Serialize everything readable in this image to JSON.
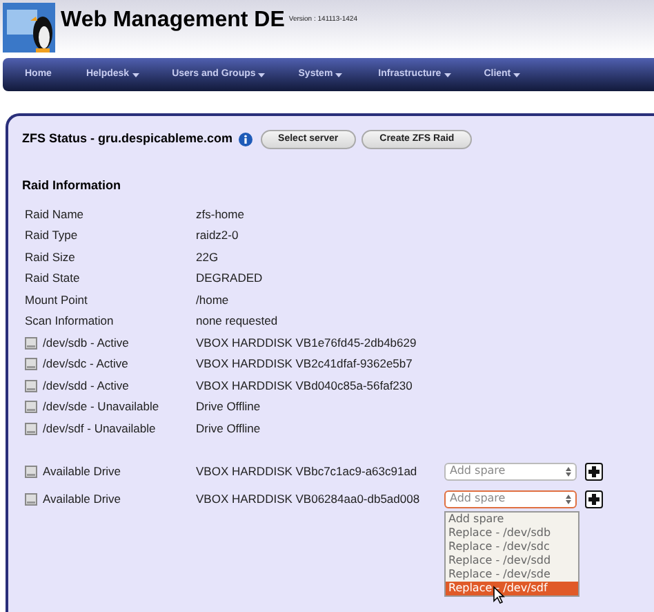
{
  "header": {
    "title": "Web Management DE",
    "version": "Version : 141113-1424"
  },
  "nav": [
    {
      "label": "Home",
      "has_menu": false
    },
    {
      "label": "Helpdesk",
      "has_menu": true
    },
    {
      "label": "Users and Groups",
      "has_menu": true
    },
    {
      "label": "System",
      "has_menu": true
    },
    {
      "label": "Infrastructure",
      "has_menu": true
    },
    {
      "label": "Client",
      "has_menu": true
    }
  ],
  "panel": {
    "title": "ZFS Status - gru.despicableme.com",
    "buttons": [
      "Select server",
      "Create ZFS Raid"
    ],
    "section_title": "Raid Information",
    "info": [
      {
        "label": "Raid Name",
        "value": "zfs-home"
      },
      {
        "label": "Raid Type",
        "value": "raidz2-0"
      },
      {
        "label": "Raid Size",
        "value": "22G"
      },
      {
        "label": "Raid State",
        "value": "DEGRADED"
      },
      {
        "label": "Mount Point",
        "value": "/home"
      },
      {
        "label": "Scan Information",
        "value": "none requested"
      }
    ],
    "drives": [
      {
        "label": "/dev/sdb - Active",
        "value": "VBOX HARDDISK VB1e76fd45-2db4b629"
      },
      {
        "label": "/dev/sdc - Active",
        "value": "VBOX HARDDISK VB2c41dfaf-9362e5b7"
      },
      {
        "label": "/dev/sdd - Active",
        "value": "VBOX HARDDISK VBd040c85a-56faf230"
      },
      {
        "label": "/dev/sde - Unavailable",
        "value": "Drive Offline"
      },
      {
        "label": "/dev/sdf - Unavailable",
        "value": "Drive Offline"
      }
    ],
    "available": [
      {
        "label": "Available Drive",
        "value": "VBOX HARDDISK VBbc7c1ac9-a63c91ad",
        "select": "Add spare",
        "expanded": false
      },
      {
        "label": "Available Drive",
        "value": "VBOX HARDDISK VB06284aa0-db5ad008",
        "select": "Add spare",
        "expanded": true
      }
    ],
    "options": [
      {
        "label": "Add spare",
        "selected": false
      },
      {
        "label": "Replace - /dev/sdb",
        "selected": false
      },
      {
        "label": "Replace - /dev/sdc",
        "selected": false
      },
      {
        "label": "Replace - /dev/sdd",
        "selected": false
      },
      {
        "label": "Replace - /dev/sde",
        "selected": false
      },
      {
        "label": "Replace - /dev/sdf",
        "selected": true
      }
    ]
  }
}
